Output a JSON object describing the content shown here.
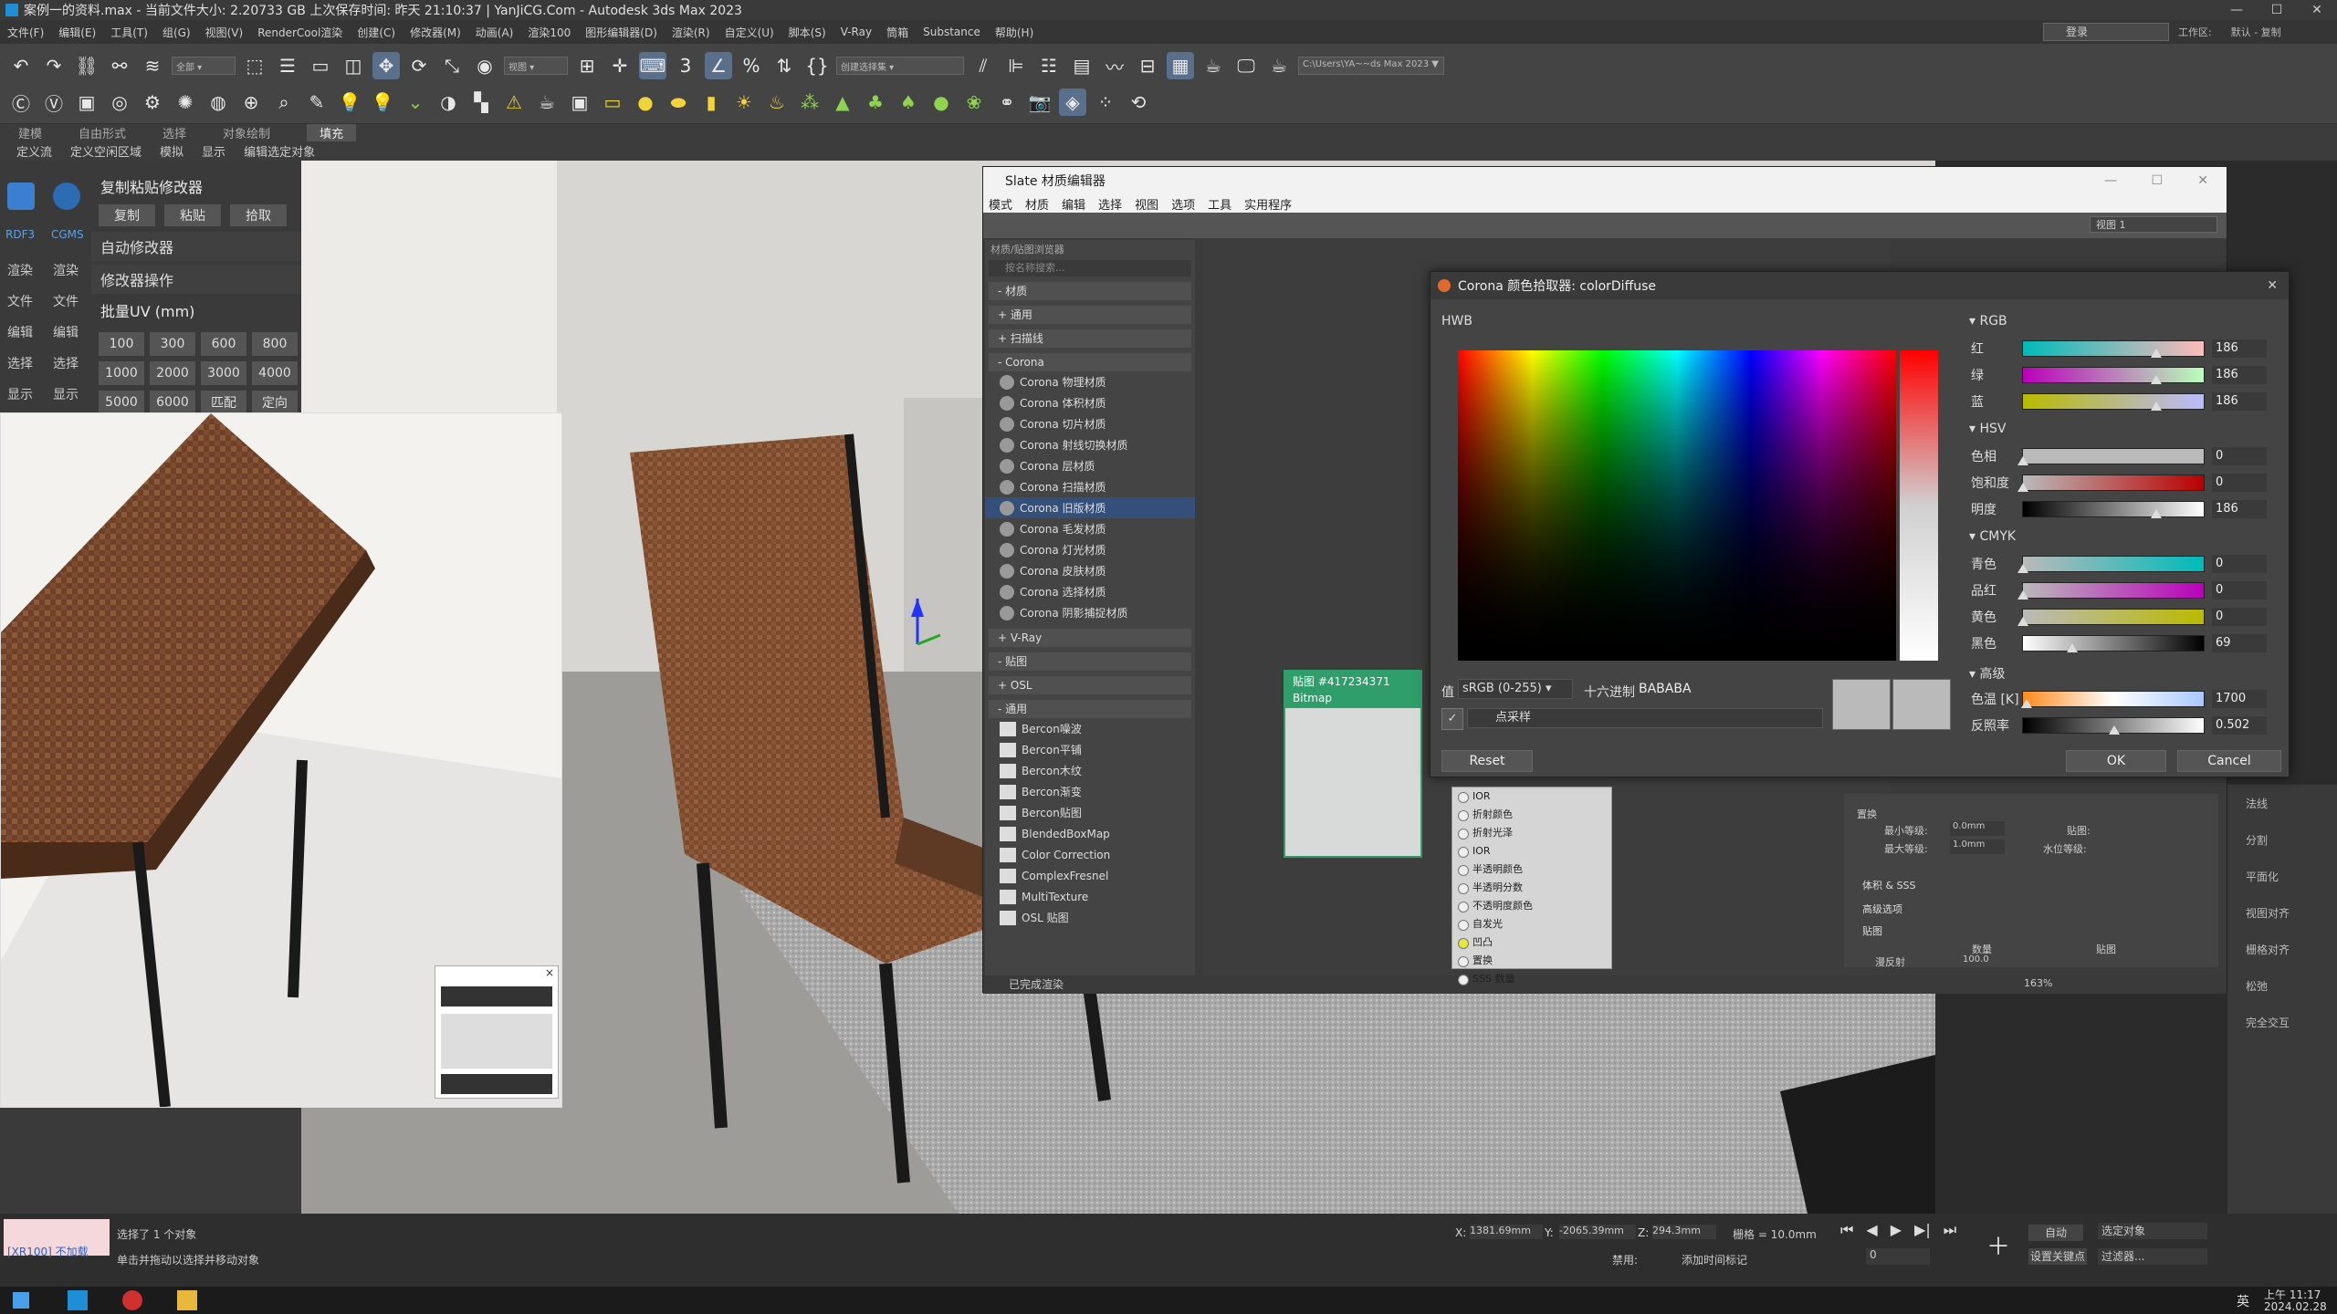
{
  "titlebar": {
    "title": "案例一的资料.max - 当前文件大小: 2.20733 GB    上次保存时间: 昨天 21:10:37  |  YanJiCG.Com  - Autodesk 3ds Max 2023",
    "minimize": "—",
    "maximize": "☐",
    "close": "✕"
  },
  "menubar": {
    "items": [
      "文件(F)",
      "编辑(E)",
      "工具(T)",
      "组(G)",
      "视图(V)",
      "RenderCool渲染",
      "创建(C)",
      "修改器(M)",
      "动画(A)",
      "渲染100",
      "图形编辑器(D)",
      "渲染(R)",
      "自定义(U)",
      "脚本(S)",
      "V-Ray",
      "筒箱",
      "Substance",
      "帮助(H)"
    ],
    "login": "登录",
    "workspace_label": "工作区:",
    "workspace_value": "默认 - 复制"
  },
  "toolbar": {
    "selection_filter": "全部",
    "view_label": "视图",
    "named_selection": "创建选择集",
    "path": "C:\\Users\\YA~~ds Max 2023 ▼"
  },
  "ribbon": {
    "tabs": [
      "建模",
      "自由形式",
      "选择",
      "对象绘制",
      "填充"
    ],
    "active_tab": "填充",
    "sub": [
      "定义流",
      "定义空闲区域",
      "模拟",
      "显示",
      "编辑选定对象"
    ]
  },
  "sidepanel": {
    "icons": [
      {
        "name": "RDF3",
        "label": "RDF3"
      },
      {
        "name": "CGMS",
        "label": "CGMS"
      }
    ],
    "left_labels": [
      "渲染",
      "文件",
      "编辑",
      "选择",
      "显示"
    ],
    "right_labels": [
      "渲染",
      "文件",
      "编辑",
      "选择",
      "显示"
    ],
    "copy_paste_title": "复制粘贴修改器",
    "copy": "复制",
    "paste": "粘贴",
    "pick": "拾取",
    "auto_modifier": "自动修改器",
    "modifier_ops": "修改器操作",
    "batch_uv": "批量UV (mm)",
    "uv_values": [
      "100",
      "300",
      "600",
      "800",
      "1000",
      "2000",
      "3000",
      "4000",
      "5000",
      "6000",
      "匹配",
      "定向"
    ]
  },
  "slate": {
    "title": "Slate 材质编辑器",
    "menu": [
      "模式",
      "材质",
      "编辑",
      "选择",
      "视图",
      "选项",
      "工具",
      "实用程序"
    ],
    "view_dropdown": "视图 1",
    "browser_header": "材质/贴图浏览器",
    "search_placeholder": "按名称搜索...",
    "groups": [
      "- 材质",
      "+ 通用",
      "+ 扫描线",
      "- Corona"
    ],
    "corona_materials": [
      "Corona 物理材质",
      "Corona 体积材质",
      "Corona 切片材质",
      "Corona 射线切换材质",
      "Corona 层材质",
      "Corona 扫描材质",
      "Corona 旧版材质",
      "Corona 毛发材质",
      "Corona 灯光材质",
      "Corona 皮肤材质",
      "Corona 选择材质",
      "Corona 阴影捕捉材质"
    ],
    "selected_index": 6,
    "more_groups": [
      "+ V-Ray",
      "- 贴图",
      "+ OSL",
      "- 通用"
    ],
    "maps": [
      "Bercon噪波",
      "Bercon平铺",
      "Bercon木纹",
      "Bercon渐变",
      "Bercon贴图",
      "BlendedBoxMap",
      "Color Correction",
      "ComplexFresnel",
      "MultiTexture",
      "OSL 贴图"
    ],
    "status": "已完成渲染",
    "zoom": "163%",
    "view_label": "视图 1"
  },
  "node": {
    "title": "贴图 #417234371",
    "subtitle": "Bitmap"
  },
  "node2": {
    "slots": [
      "IOR",
      "折射颜色",
      "折射光泽",
      "IOR",
      "半透明颜色",
      "半透明分数",
      "不透明度颜色",
      "自发光",
      "凹凸",
      "置换",
      "SSS 数量"
    ],
    "highlight_index": 8
  },
  "mat_params": {
    "displace": "置换",
    "min_level": "最小等级:",
    "min_value": "0.0mm",
    "max_level": "最大等级:",
    "max_value": "1.0mm",
    "water_level": "水位等级:",
    "map": "贴图:",
    "volume": "体积 & SSS",
    "advanced": "高级选项",
    "maps": "贴图",
    "amount": "数量",
    "map_col": "贴图",
    "diffuse": "漫反射",
    "diffuse_amount": "100.0"
  },
  "picker": {
    "title": "Corona 颜色拾取器: colorDiffuse",
    "mode": "HWB",
    "rgb_label": "RGB",
    "rgb": [
      {
        "label": "红",
        "value": "186",
        "knob": 0.73
      },
      {
        "label": "绿",
        "value": "186",
        "knob": 0.73
      },
      {
        "label": "蓝",
        "value": "186",
        "knob": 0.73
      }
    ],
    "hsv_label": "HSV",
    "hsv": [
      {
        "label": "色相",
        "value": "0",
        "knob": 0
      },
      {
        "label": "饱和度",
        "value": "0",
        "knob": 0
      },
      {
        "label": "明度",
        "value": "186",
        "knob": 0.73
      }
    ],
    "cmyk_label": "CMYK",
    "cmyk": [
      {
        "label": "青色",
        "value": "0",
        "knob": 0
      },
      {
        "label": "品红",
        "value": "0",
        "knob": 0
      },
      {
        "label": "黄色",
        "value": "0",
        "knob": 0
      },
      {
        "label": "黑色",
        "value": "69",
        "knob": 0.27
      }
    ],
    "advanced_label": "高级",
    "temperature_label": "色温 [K]",
    "temperature_value": "1700",
    "reflectance_label": "反照率",
    "reflectance_value": "0.502",
    "value_label": "值",
    "color_space": "sRGB (0-255)",
    "hex_label": "十六进制",
    "hex_value": "BABABA",
    "sample_label": "点采样",
    "reset": "Reset",
    "ok": "OK",
    "cancel": "Cancel",
    "swatch_color": "#BABABA"
  },
  "right_panel": {
    "labels": [
      "法线",
      "分割",
      "平面化",
      "视图对齐",
      "栅格对齐",
      "松弛",
      "完全交互"
    ]
  },
  "status": {
    "selected": "选择了 1 个对象",
    "prompt": "单击并拖动以选择并移动对象",
    "script": "[XR100]  不加载",
    "x_label": "X:",
    "x_value": "1381.69mm",
    "y_label": "Y:",
    "y_value": "-2065.39mm",
    "z_label": "Z:",
    "z_value": "294.3mm",
    "grid": "栅格 = 10.0mm",
    "auto": "自动",
    "selected_obj": "选定对象",
    "set_key": "设置关键点",
    "filters": "过滤器...",
    "disabled": "禁用:",
    "add_time_tag": "添加时间标记",
    "frame": "0"
  },
  "taskbar": {
    "time": "上午 11:17",
    "date": "2024.02.28",
    "ime": "英"
  }
}
